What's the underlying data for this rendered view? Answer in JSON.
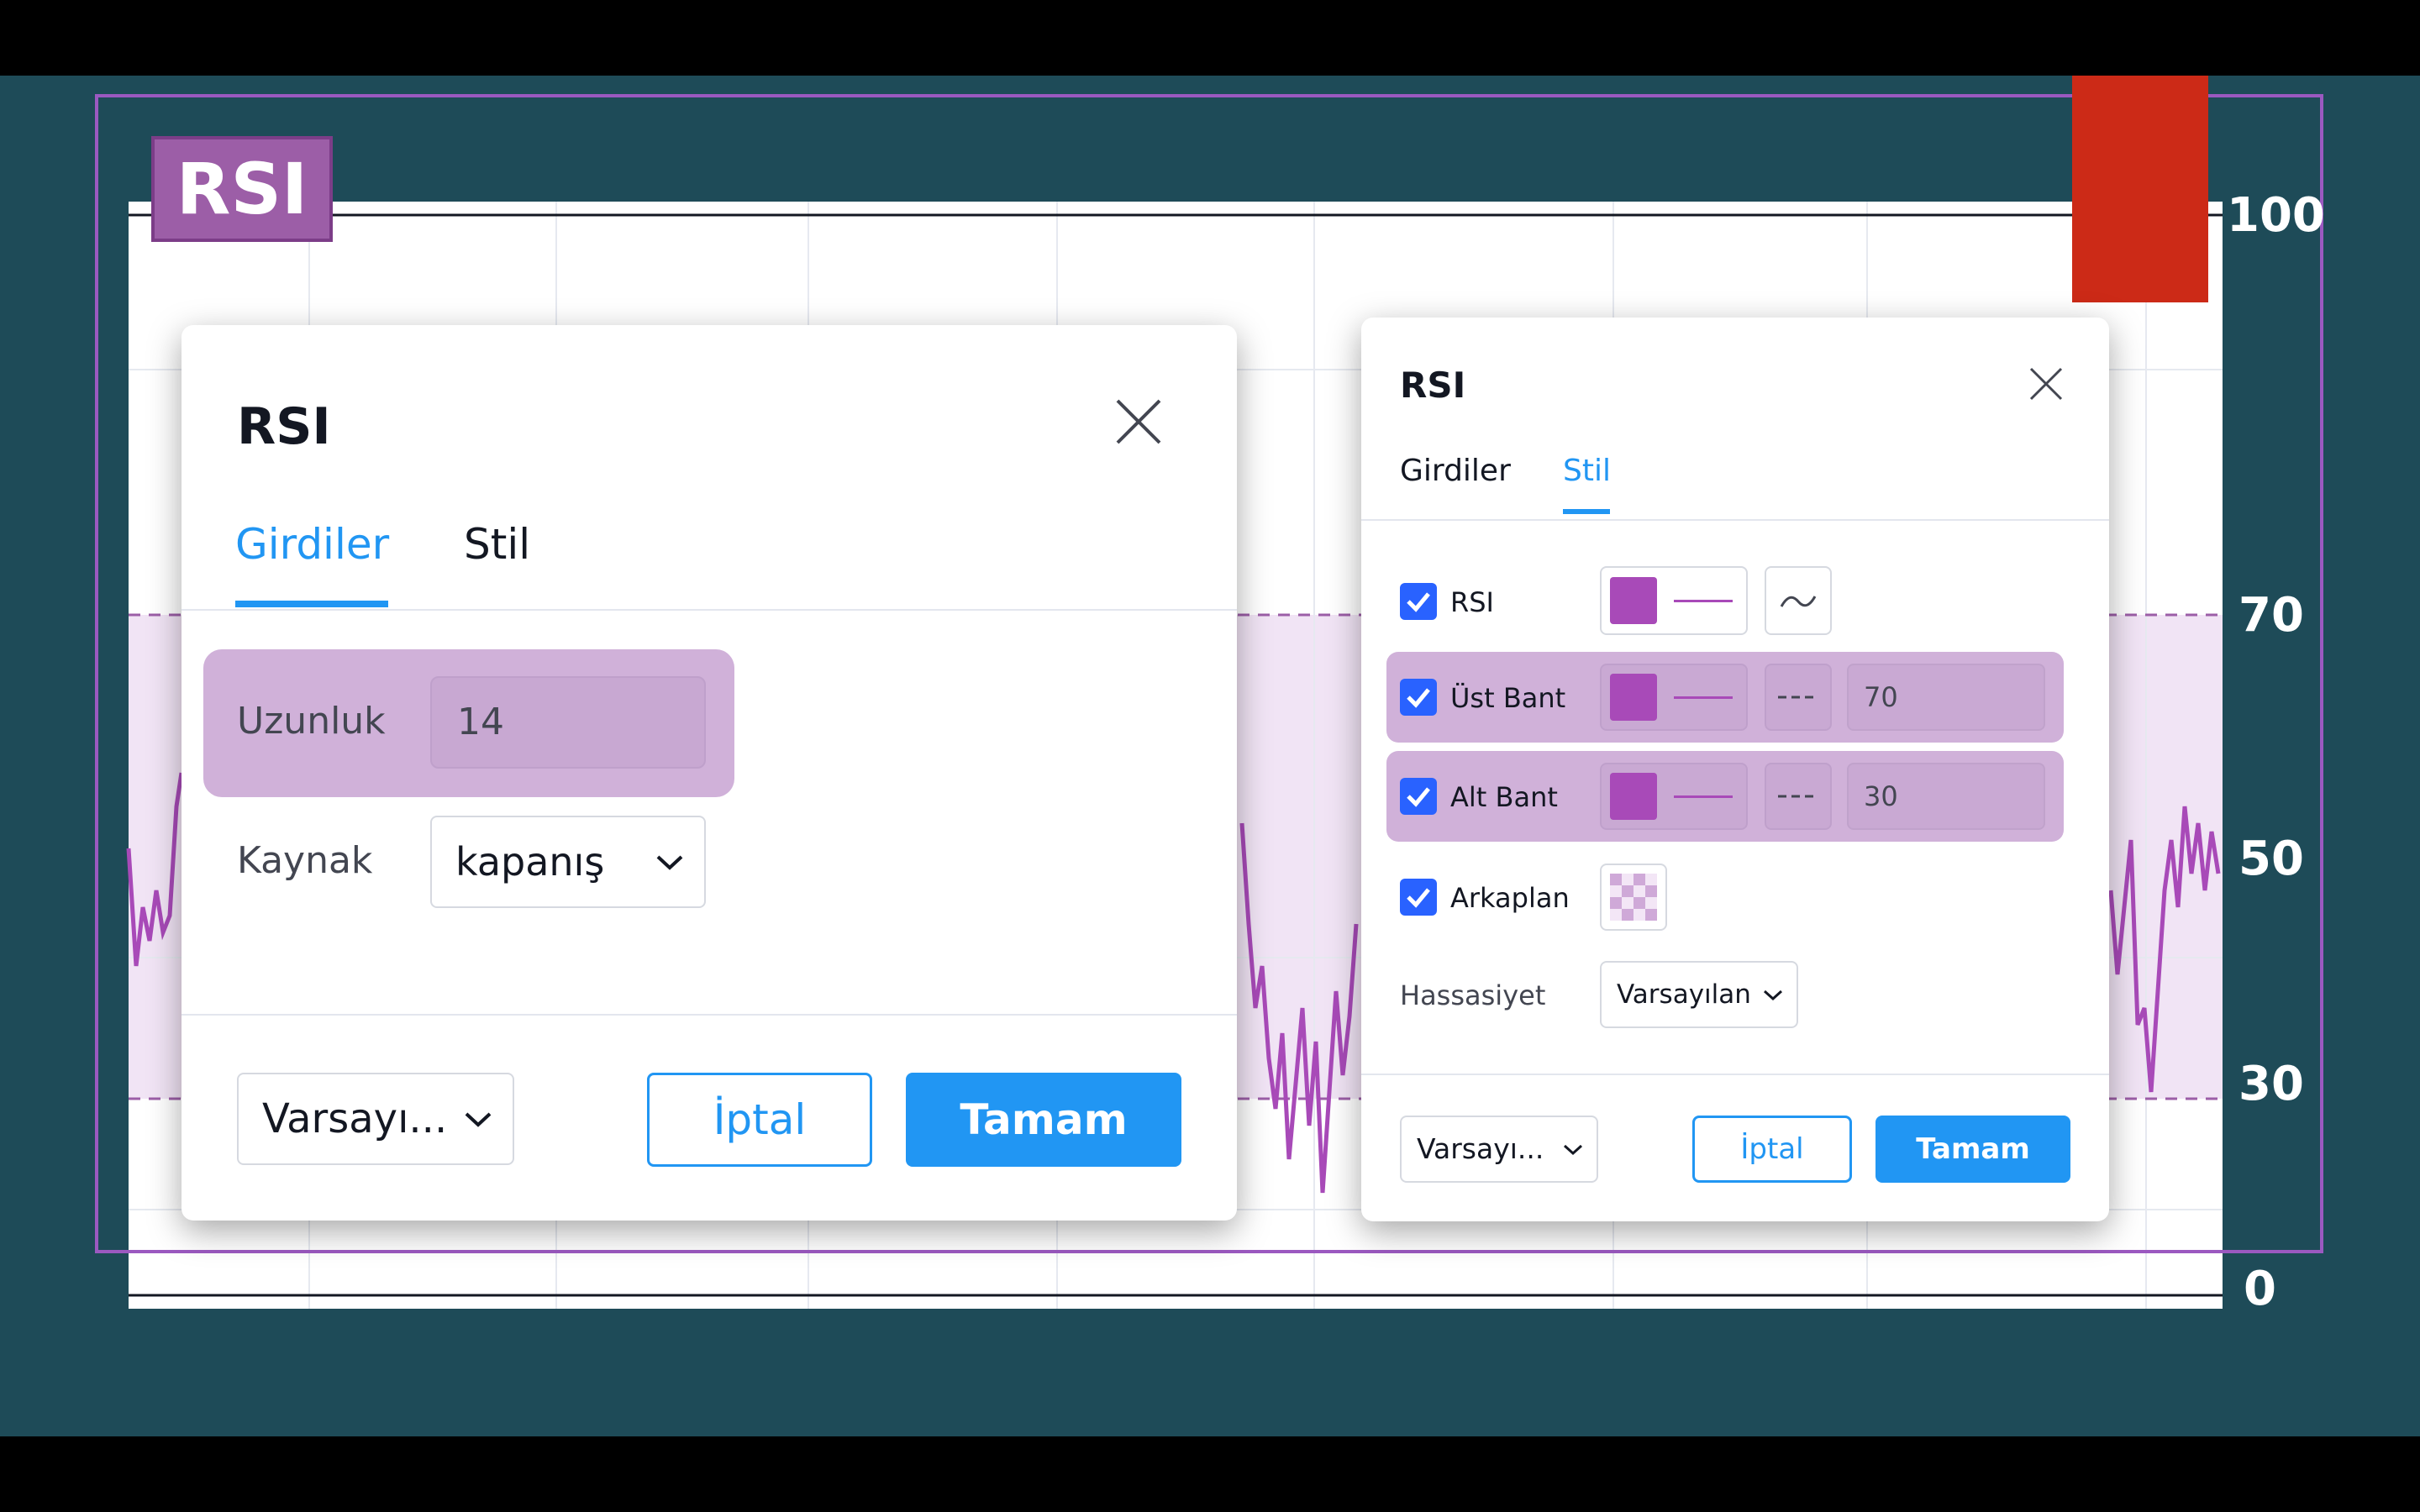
{
  "badge": {
    "text": "RSI"
  },
  "axis": {
    "labels": [
      "100",
      "70",
      "50",
      "30",
      "0"
    ]
  },
  "colors": {
    "accent": "#2196f3",
    "rsi_line": "#a84ab8",
    "band_fill": "#f1e4f5",
    "highlight": "#d0b1d9"
  },
  "dialog_left": {
    "title": "RSI",
    "tabs": [
      "Girdiler",
      "Stil"
    ],
    "active_tab": "Girdiler",
    "length_label": "Uzunluk",
    "length_value": "14",
    "source_label": "Kaynak",
    "source_value": "kapanış",
    "defaults": "Varsayı...",
    "cancel": "İptal",
    "ok": "Tamam",
    "close_icon": "close-icon"
  },
  "dialog_right": {
    "title": "RSI",
    "tabs": [
      "Girdiler",
      "Stil"
    ],
    "active_tab": "Stil",
    "rows": [
      {
        "label": "RSI",
        "checked": true
      },
      {
        "label": "Üst Bant",
        "checked": true,
        "value": "70"
      },
      {
        "label": "Alt Bant",
        "checked": true,
        "value": "30"
      },
      {
        "label": "Arkaplan",
        "checked": true
      }
    ],
    "precision_label": "Hassasiyet",
    "precision_value": "Varsayılan",
    "defaults": "Varsayı...",
    "cancel": "İptal",
    "ok": "Tamam"
  }
}
